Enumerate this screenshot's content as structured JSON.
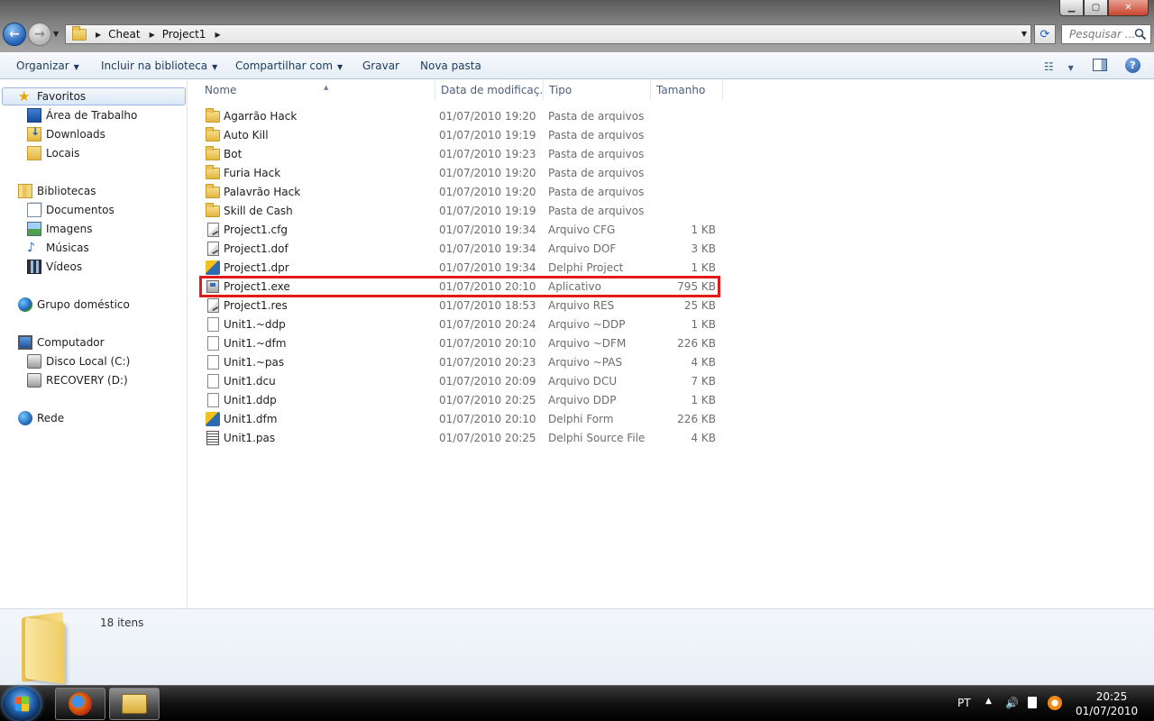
{
  "titlebar": {
    "breadcrumb": [
      "Cheat",
      "Project1"
    ],
    "search_placeholder": "Pesquisar ..."
  },
  "commandbar": {
    "organize": "Organizar",
    "include_library": "Incluir na biblioteca",
    "share_with": "Compartilhar com",
    "burn": "Gravar",
    "new_folder": "Nova pasta"
  },
  "navpane": {
    "favorites": "Favoritos",
    "desktop": "Área de Trabalho",
    "downloads": "Downloads",
    "recent_places": "Locais",
    "libraries": "Bibliotecas",
    "documents": "Documentos",
    "pictures": "Imagens",
    "music": "Músicas",
    "videos": "Vídeos",
    "homegroup": "Grupo doméstico",
    "computer": "Computador",
    "drive_c": "Disco Local (C:)",
    "drive_d": "RECOVERY (D:)",
    "network": "Rede"
  },
  "columns": {
    "name": "Nome",
    "date": "Data de modificaç...",
    "type": "Tipo",
    "size": "Tamanho"
  },
  "files": [
    {
      "name": "Agarrão Hack",
      "date": "01/07/2010 19:20",
      "type": "Pasta de arquivos",
      "size": "",
      "icon": "folder-icon"
    },
    {
      "name": "Auto Kill",
      "date": "01/07/2010 19:19",
      "type": "Pasta de arquivos",
      "size": "",
      "icon": "folder-icon"
    },
    {
      "name": "Bot",
      "date": "01/07/2010 19:23",
      "type": "Pasta de arquivos",
      "size": "",
      "icon": "folder-icon"
    },
    {
      "name": "Furia Hack",
      "date": "01/07/2010 19:20",
      "type": "Pasta de arquivos",
      "size": "",
      "icon": "folder-icon"
    },
    {
      "name": "Palavrão Hack",
      "date": "01/07/2010 19:20",
      "type": "Pasta de arquivos",
      "size": "",
      "icon": "folder-icon"
    },
    {
      "name": "Skill de Cash",
      "date": "01/07/2010 19:19",
      "type": "Pasta de arquivos",
      "size": "",
      "icon": "folder-icon"
    },
    {
      "name": "Project1.cfg",
      "date": "01/07/2010 19:34",
      "type": "Arquivo CFG",
      "size": "1 KB",
      "icon": "config-file-icon"
    },
    {
      "name": "Project1.dof",
      "date": "01/07/2010 19:34",
      "type": "Arquivo DOF",
      "size": "3 KB",
      "icon": "config-file-icon"
    },
    {
      "name": "Project1.dpr",
      "date": "01/07/2010 19:34",
      "type": "Delphi Project",
      "size": "1 KB",
      "icon": "delphi-icon"
    },
    {
      "name": "Project1.exe",
      "date": "01/07/2010 20:10",
      "type": "Aplicativo",
      "size": "795 KB",
      "icon": "application-icon"
    },
    {
      "name": "Project1.res",
      "date": "01/07/2010 18:53",
      "type": "Arquivo RES",
      "size": "25 KB",
      "icon": "config-file-icon"
    },
    {
      "name": "Unit1.~ddp",
      "date": "01/07/2010 20:24",
      "type": "Arquivo ~DDP",
      "size": "1 KB",
      "icon": "blank-file-icon"
    },
    {
      "name": "Unit1.~dfm",
      "date": "01/07/2010 20:10",
      "type": "Arquivo ~DFM",
      "size": "226 KB",
      "icon": "blank-file-icon"
    },
    {
      "name": "Unit1.~pas",
      "date": "01/07/2010 20:23",
      "type": "Arquivo ~PAS",
      "size": "4 KB",
      "icon": "blank-file-icon"
    },
    {
      "name": "Unit1.dcu",
      "date": "01/07/2010 20:09",
      "type": "Arquivo DCU",
      "size": "7 KB",
      "icon": "blank-file-icon"
    },
    {
      "name": "Unit1.ddp",
      "date": "01/07/2010 20:25",
      "type": "Arquivo DDP",
      "size": "1 KB",
      "icon": "blank-file-icon"
    },
    {
      "name": "Unit1.dfm",
      "date": "01/07/2010 20:10",
      "type": "Delphi Form",
      "size": "226 KB",
      "icon": "delphi-icon"
    },
    {
      "name": "Unit1.pas",
      "date": "01/07/2010 20:25",
      "type": "Delphi Source File",
      "size": "4 KB",
      "icon": "pascal-source-icon"
    }
  ],
  "highlighted_file": "Project1.exe",
  "highlight_color": "#e21a1a",
  "details": {
    "item_count": "18 itens"
  },
  "taskbar": {
    "language": "PT",
    "time": "20:25",
    "date": "01/07/2010"
  }
}
